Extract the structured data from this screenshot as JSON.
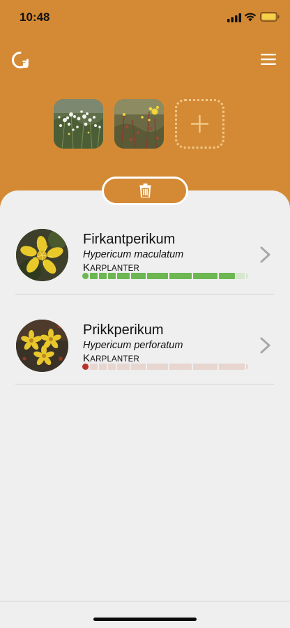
{
  "status_bar": {
    "time": "10:48"
  },
  "toolbar": {
    "logo_icon": "refresh-circle-icon",
    "menu_icon": "hamburger-menu-icon"
  },
  "photos": {
    "items": [
      {
        "label": "white-flowers-photo"
      },
      {
        "label": "yellow-flowers-photo"
      }
    ],
    "add_glyph": "+"
  },
  "delete": {
    "icon": "trash-icon"
  },
  "results": [
    {
      "common_name": "Firkantperikum",
      "latin_name": "Hypericum maculatum",
      "group_first": "K",
      "group_rest": "ARPLANTER",
      "confidence": 0.92,
      "bar_color": "#6DB753",
      "bar_track": "#D7E8CF"
    },
    {
      "common_name": "Prikkperikum",
      "latin_name": "Hypericum perforatum",
      "group_first": "K",
      "group_rest": "ARPLANTER",
      "confidence": 0.02,
      "bar_color": "#B8322A",
      "bar_track": "#E8D5CF"
    }
  ],
  "colors": {
    "brand": "#D48A34",
    "sheet": "#EFEFEF"
  }
}
